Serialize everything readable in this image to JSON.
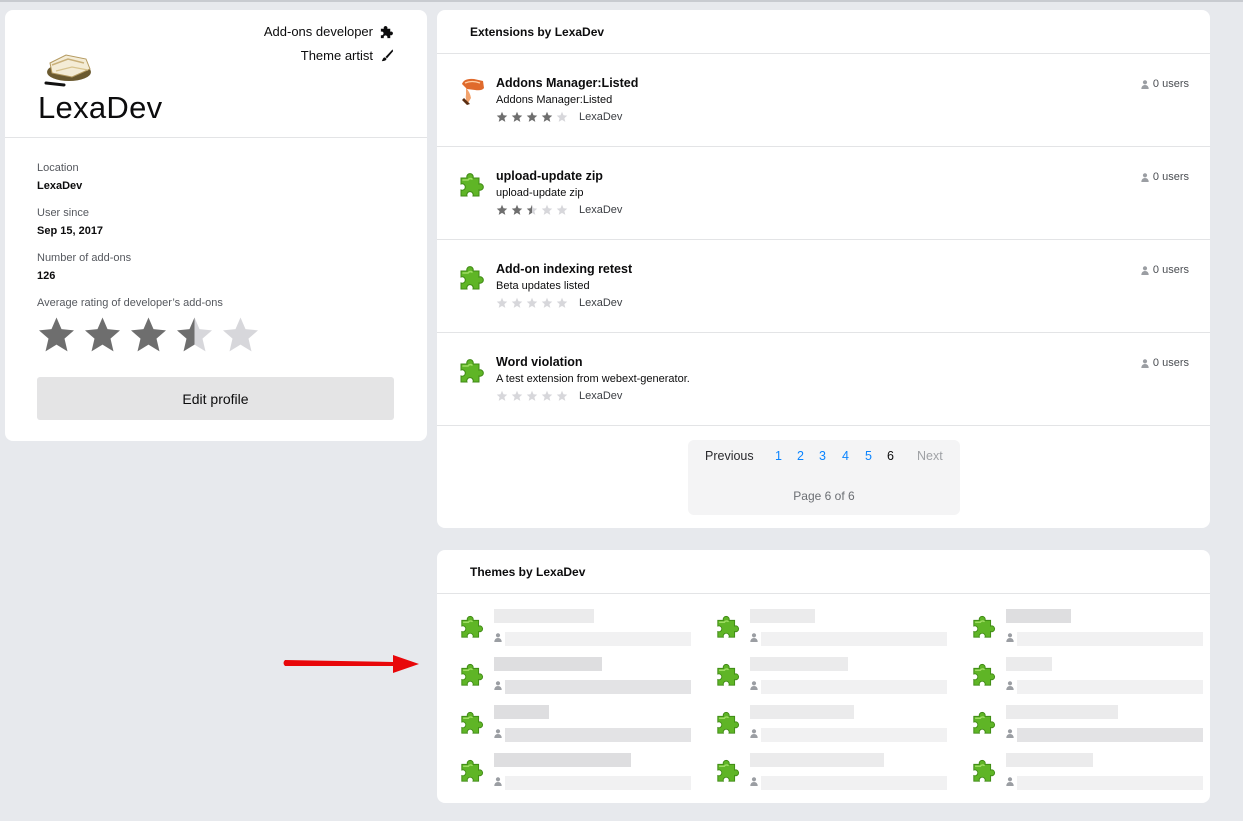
{
  "profile": {
    "name": "LexaDev",
    "roles": [
      "Add-ons developer",
      "Theme artist"
    ],
    "location_label": "Location",
    "location_value": "LexaDev",
    "user_since_label": "User since",
    "user_since_value": "Sep 15, 2017",
    "addons_count_label": "Number of add-ons",
    "addons_count_value": "126",
    "avg_rating_label": "Average rating of developer’s add-ons",
    "avg_rating": 3.5,
    "edit_button": "Edit profile"
  },
  "extensions": {
    "header": "Extensions by LexaDev",
    "items": [
      {
        "name": "Addons Manager:Listed",
        "summary": "Addons Manager:Listed",
        "author": "LexaDev",
        "users": "0 users",
        "rating": 4,
        "icon": "brush-icon"
      },
      {
        "name": "upload-update zip",
        "summary": "upload-update zip",
        "author": "LexaDev",
        "users": "0 users",
        "rating": 2.5,
        "icon": "puzzle-icon"
      },
      {
        "name": "Add-on indexing retest",
        "summary": "Beta updates listed",
        "author": "LexaDev",
        "users": "0 users",
        "rating": 0,
        "icon": "puzzle-icon"
      },
      {
        "name": "Word violation",
        "summary": "A test extension from webext-generator.",
        "author": "LexaDev",
        "users": "0 users",
        "rating": 0,
        "icon": "puzzle-icon"
      }
    ]
  },
  "pagination": {
    "previous": "Previous",
    "next": "Next",
    "pages": [
      "1",
      "2",
      "3",
      "4",
      "5",
      "6"
    ],
    "current": "6",
    "info": "Page 6 of 6"
  },
  "themes": {
    "header": "Themes by LexaDev",
    "placeholder_count": 12
  },
  "colors": {
    "accent": "#0a84ff",
    "background": "#e7e9ed",
    "puzzle_green": "#5fb526",
    "arrow_red": "#e8070a",
    "star_filled": "#6e6e6e",
    "star_empty": "#d7d7db"
  }
}
